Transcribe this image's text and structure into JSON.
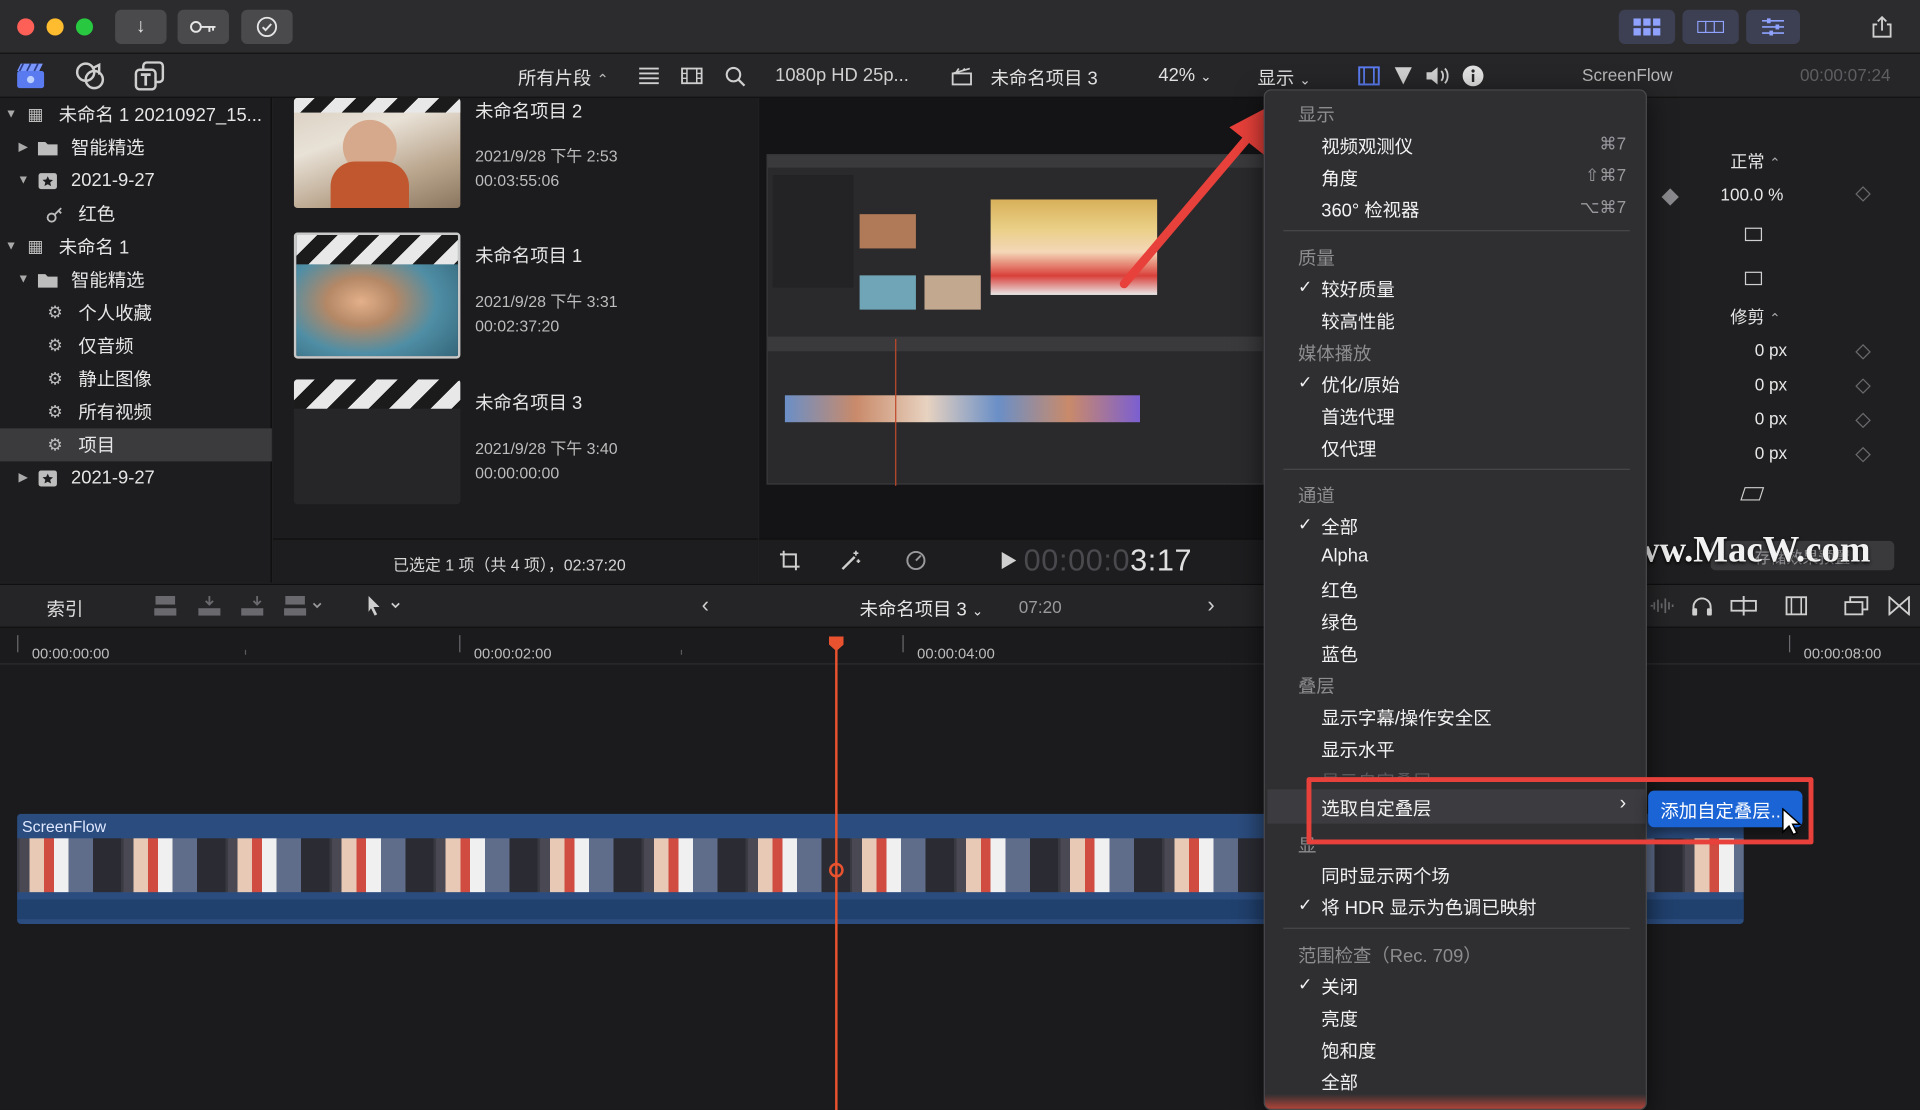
{
  "titlebar": {
    "buttons": [
      "download-icon",
      "key-icon",
      "checkmark-icon"
    ]
  },
  "toolbar": {
    "filter_label": "所有片段",
    "format": "1080p HD 25p...",
    "project": "未命名项目 3",
    "zoom": "42%",
    "view_menu": "显示",
    "inspector_title": "ScreenFlow",
    "inspector_time": "00:00:07:24"
  },
  "sidebar": {
    "items": [
      {
        "label": "未命名 1 20210927_15..."
      },
      {
        "label": "智能精选"
      },
      {
        "label": "2021-9-27"
      },
      {
        "label": "红色"
      },
      {
        "label": "未命名 1"
      },
      {
        "label": "智能精选"
      },
      {
        "label": "个人收藏"
      },
      {
        "label": "仅音频"
      },
      {
        "label": "静止图像"
      },
      {
        "label": "所有视频"
      },
      {
        "label": "项目"
      },
      {
        "label": "2021-9-27"
      }
    ]
  },
  "browser": {
    "items": [
      {
        "title": "未命名项目 2",
        "date": "2021/9/28 下午 2:53",
        "duration": "00:03:55:06"
      },
      {
        "title": "未命名项目 1",
        "date": "2021/9/28 下午 3:31",
        "duration": "00:02:37:20"
      },
      {
        "title": "未命名项目 3",
        "date": "2021/9/28 下午 3:40",
        "duration": "00:00:00:00"
      }
    ],
    "status": "已选定 1 项（共 4 项），02:37:20"
  },
  "viewer": {
    "timecode_dim": "00:00:0",
    "timecode": "3:17"
  },
  "inspector": {
    "blend_mode": "正常",
    "opacity": "100.0 %",
    "crop_label": "修剪",
    "px_values": [
      "0 px",
      "0 px",
      "0 px",
      "0 px"
    ],
    "save_label": "存储效果预置"
  },
  "watermark": "www.MacW.com",
  "timeline_bar": {
    "index_label": "索引",
    "project": "未命名项目 3",
    "duration": "07:20"
  },
  "timeline": {
    "ticks": [
      "00:00:00:00",
      "00:00:02:00",
      "00:00:04:00",
      "00:00:08:00"
    ],
    "clip_name": "ScreenFlow"
  },
  "menu": {
    "section_display": "显示",
    "video_scope": "视频观测仪",
    "video_scope_key": "⌘7",
    "angle": "角度",
    "angle_key": "⇧⌘7",
    "viewer360": "360° 检视器",
    "viewer360_key": "⌥⌘7",
    "section_quality": "质量",
    "better_quality": "较好质量",
    "better_performance": "较高性能",
    "section_media": "媒体播放",
    "optimized": "优化/原始",
    "proxy_preferred": "首选代理",
    "proxy_only": "仅代理",
    "section_channels": "通道",
    "ch_all": "全部",
    "ch_alpha": "Alpha",
    "ch_red": "红色",
    "ch_green": "绿色",
    "ch_blue": "蓝色",
    "section_overlay": "叠层",
    "title_safe": "显示字幕/操作安全区",
    "horizon": "显示水平",
    "custom_overlay_hidden": "显示自定叠层",
    "choose_overlay": "选取自定叠层",
    "section_show_hidden": "显",
    "show_both": "同时显示两个场",
    "hdr_tonemap": "将 HDR 显示为色调已映射",
    "section_range": "范围检查（Rec. 709）",
    "range_off": "关闭",
    "range_luma": "亮度",
    "range_sat": "饱和度",
    "range_all": "全部"
  },
  "submenu": {
    "add_overlay": "添加自定叠层..."
  },
  "colors": {
    "accent": "#1a64d6",
    "highlight_box": "#e8403a",
    "playhead": "#e8522e",
    "clip_blue": "#2b4c7e"
  }
}
